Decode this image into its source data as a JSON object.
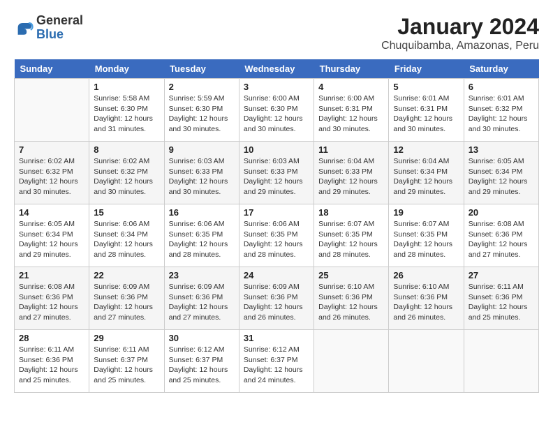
{
  "header": {
    "logo_line1": "General",
    "logo_line2": "Blue",
    "title": "January 2024",
    "subtitle": "Chuquibamba, Amazonas, Peru"
  },
  "weekdays": [
    "Sunday",
    "Monday",
    "Tuesday",
    "Wednesday",
    "Thursday",
    "Friday",
    "Saturday"
  ],
  "weeks": [
    [
      {
        "day": "",
        "info": ""
      },
      {
        "day": "1",
        "info": "Sunrise: 5:58 AM\nSunset: 6:30 PM\nDaylight: 12 hours\nand 31 minutes."
      },
      {
        "day": "2",
        "info": "Sunrise: 5:59 AM\nSunset: 6:30 PM\nDaylight: 12 hours\nand 30 minutes."
      },
      {
        "day": "3",
        "info": "Sunrise: 6:00 AM\nSunset: 6:30 PM\nDaylight: 12 hours\nand 30 minutes."
      },
      {
        "day": "4",
        "info": "Sunrise: 6:00 AM\nSunset: 6:31 PM\nDaylight: 12 hours\nand 30 minutes."
      },
      {
        "day": "5",
        "info": "Sunrise: 6:01 AM\nSunset: 6:31 PM\nDaylight: 12 hours\nand 30 minutes."
      },
      {
        "day": "6",
        "info": "Sunrise: 6:01 AM\nSunset: 6:32 PM\nDaylight: 12 hours\nand 30 minutes."
      }
    ],
    [
      {
        "day": "7",
        "info": "Sunrise: 6:02 AM\nSunset: 6:32 PM\nDaylight: 12 hours\nand 30 minutes."
      },
      {
        "day": "8",
        "info": "Sunrise: 6:02 AM\nSunset: 6:32 PM\nDaylight: 12 hours\nand 30 minutes."
      },
      {
        "day": "9",
        "info": "Sunrise: 6:03 AM\nSunset: 6:33 PM\nDaylight: 12 hours\nand 30 minutes."
      },
      {
        "day": "10",
        "info": "Sunrise: 6:03 AM\nSunset: 6:33 PM\nDaylight: 12 hours\nand 29 minutes."
      },
      {
        "day": "11",
        "info": "Sunrise: 6:04 AM\nSunset: 6:33 PM\nDaylight: 12 hours\nand 29 minutes."
      },
      {
        "day": "12",
        "info": "Sunrise: 6:04 AM\nSunset: 6:34 PM\nDaylight: 12 hours\nand 29 minutes."
      },
      {
        "day": "13",
        "info": "Sunrise: 6:05 AM\nSunset: 6:34 PM\nDaylight: 12 hours\nand 29 minutes."
      }
    ],
    [
      {
        "day": "14",
        "info": "Sunrise: 6:05 AM\nSunset: 6:34 PM\nDaylight: 12 hours\nand 29 minutes."
      },
      {
        "day": "15",
        "info": "Sunrise: 6:06 AM\nSunset: 6:34 PM\nDaylight: 12 hours\nand 28 minutes."
      },
      {
        "day": "16",
        "info": "Sunrise: 6:06 AM\nSunset: 6:35 PM\nDaylight: 12 hours\nand 28 minutes."
      },
      {
        "day": "17",
        "info": "Sunrise: 6:06 AM\nSunset: 6:35 PM\nDaylight: 12 hours\nand 28 minutes."
      },
      {
        "day": "18",
        "info": "Sunrise: 6:07 AM\nSunset: 6:35 PM\nDaylight: 12 hours\nand 28 minutes."
      },
      {
        "day": "19",
        "info": "Sunrise: 6:07 AM\nSunset: 6:35 PM\nDaylight: 12 hours\nand 28 minutes."
      },
      {
        "day": "20",
        "info": "Sunrise: 6:08 AM\nSunset: 6:36 PM\nDaylight: 12 hours\nand 27 minutes."
      }
    ],
    [
      {
        "day": "21",
        "info": "Sunrise: 6:08 AM\nSunset: 6:36 PM\nDaylight: 12 hours\nand 27 minutes."
      },
      {
        "day": "22",
        "info": "Sunrise: 6:09 AM\nSunset: 6:36 PM\nDaylight: 12 hours\nand 27 minutes."
      },
      {
        "day": "23",
        "info": "Sunrise: 6:09 AM\nSunset: 6:36 PM\nDaylight: 12 hours\nand 27 minutes."
      },
      {
        "day": "24",
        "info": "Sunrise: 6:09 AM\nSunset: 6:36 PM\nDaylight: 12 hours\nand 26 minutes."
      },
      {
        "day": "25",
        "info": "Sunrise: 6:10 AM\nSunset: 6:36 PM\nDaylight: 12 hours\nand 26 minutes."
      },
      {
        "day": "26",
        "info": "Sunrise: 6:10 AM\nSunset: 6:36 PM\nDaylight: 12 hours\nand 26 minutes."
      },
      {
        "day": "27",
        "info": "Sunrise: 6:11 AM\nSunset: 6:36 PM\nDaylight: 12 hours\nand 25 minutes."
      }
    ],
    [
      {
        "day": "28",
        "info": "Sunrise: 6:11 AM\nSunset: 6:36 PM\nDaylight: 12 hours\nand 25 minutes."
      },
      {
        "day": "29",
        "info": "Sunrise: 6:11 AM\nSunset: 6:37 PM\nDaylight: 12 hours\nand 25 minutes."
      },
      {
        "day": "30",
        "info": "Sunrise: 6:12 AM\nSunset: 6:37 PM\nDaylight: 12 hours\nand 25 minutes."
      },
      {
        "day": "31",
        "info": "Sunrise: 6:12 AM\nSunset: 6:37 PM\nDaylight: 12 hours\nand 24 minutes."
      },
      {
        "day": "",
        "info": ""
      },
      {
        "day": "",
        "info": ""
      },
      {
        "day": "",
        "info": ""
      }
    ]
  ]
}
